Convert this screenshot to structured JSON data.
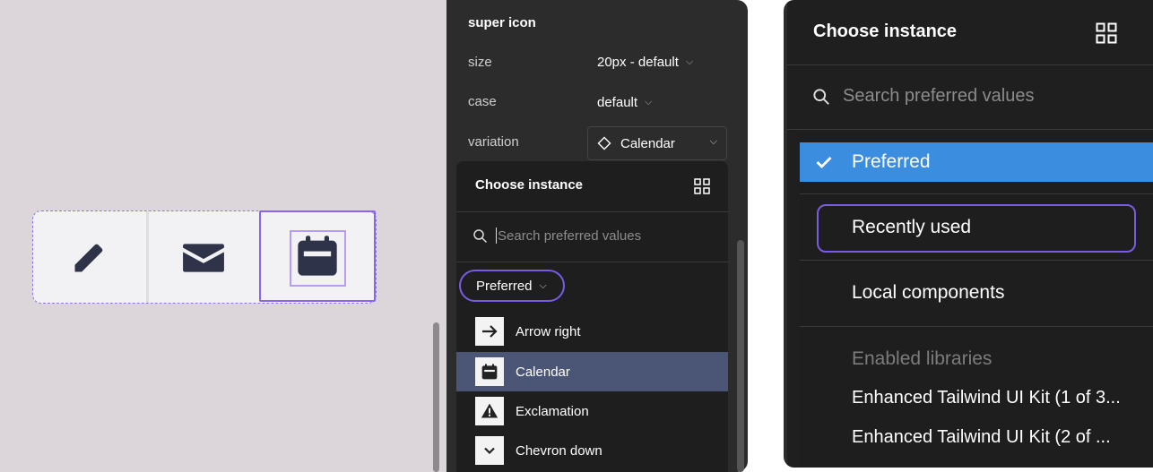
{
  "canvas": {
    "icons": [
      "pencil-icon",
      "envelope-icon",
      "calendar-icon"
    ],
    "selected_icon": "calendar-icon"
  },
  "properties": {
    "title": "super icon",
    "rows": [
      {
        "label": "size",
        "value": "20px - default"
      },
      {
        "label": "case",
        "value": "default"
      },
      {
        "label": "variation",
        "value": "Calendar"
      }
    ]
  },
  "instance_popup": {
    "title": "Choose instance",
    "search_placeholder": "Search preferred values",
    "filter_label": "Preferred",
    "items": [
      {
        "label": "Arrow right",
        "icon": "arrow-right-icon"
      },
      {
        "label": "Calendar",
        "icon": "calendar-icon",
        "active": true
      },
      {
        "label": "Exclamation",
        "icon": "exclamation-triangle-icon"
      },
      {
        "label": "Chevron down",
        "icon": "chevron-down-icon"
      }
    ]
  },
  "zoomed_popup": {
    "title": "Choose instance",
    "search_placeholder": "Search preferred values",
    "menu": {
      "selected": "Preferred",
      "options": [
        "Recently used",
        "Local components"
      ],
      "section_header": "Enabled libraries",
      "libraries": [
        "Enhanced Tailwind UI Kit (1 of 3...",
        "Enhanced Tailwind UI Kit (2 of ..."
      ]
    }
  },
  "colors": {
    "canvas_bg": "#dcd6da",
    "panel_bg": "#2c2c2c",
    "popup_bg": "#1e1e1e",
    "selection_purple": "#8b63ee",
    "active_row": "#4b5575",
    "selected_blue": "#3b8de0",
    "icon_dark": "#2f3349"
  }
}
